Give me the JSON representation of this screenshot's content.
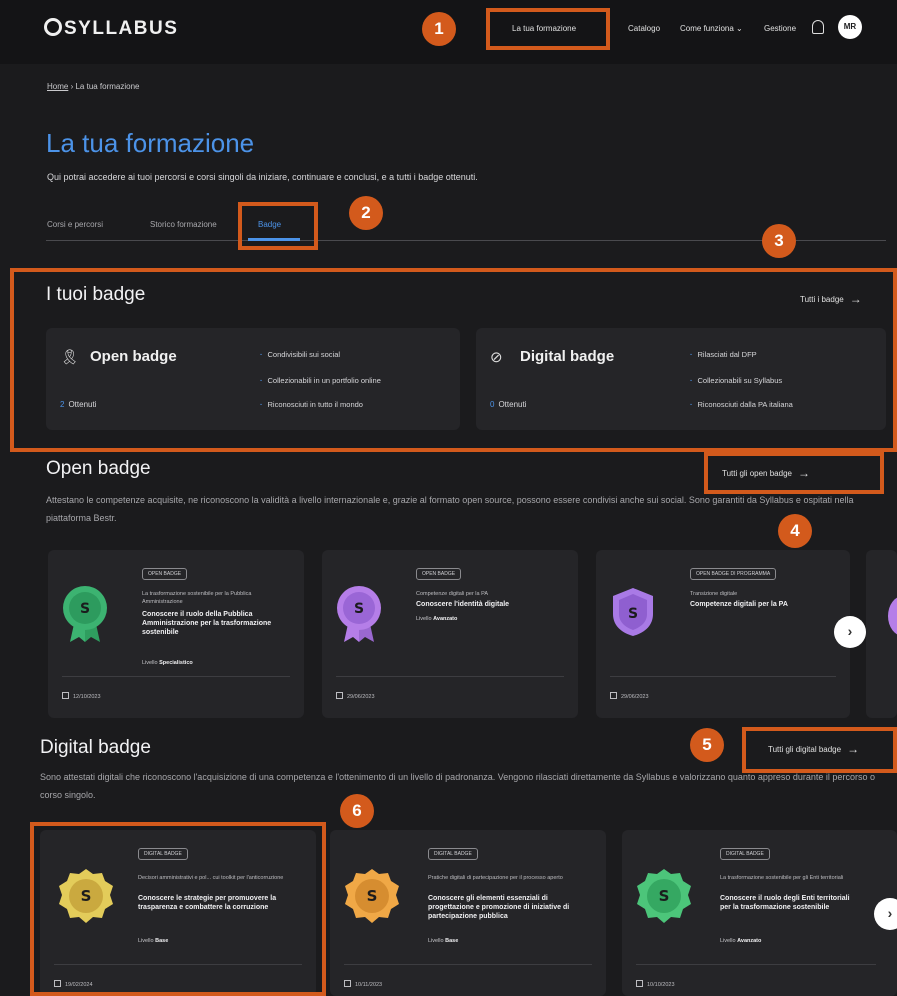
{
  "header": {
    "logo": "SYLLABUS",
    "nav": [
      "La tua formazione",
      "Catalogo",
      "Come funziona",
      "Gestione"
    ],
    "avatar_initials": "MR"
  },
  "breadcrumb": {
    "home": "Home",
    "current": "La tua formazione"
  },
  "page": {
    "title": "La tua formazione",
    "subtitle": "Qui potrai accedere ai tuoi percorsi e corsi singoli da iniziare, continuare e conclusi, e a tutti i badge ottenuti."
  },
  "tabs": [
    "Corsi e percorsi",
    "Storico formazione",
    "Badge"
  ],
  "summary": {
    "title": "I tuoi badge",
    "see_all": "Tutti i badge",
    "open": {
      "title": "Open badge",
      "count": "2",
      "count_label": "Ottenuti",
      "features": [
        "Condivisibili sui social",
        "Collezionabili in un portfolio online",
        "Riconosciuti in tutto il mondo"
      ]
    },
    "digital": {
      "title": "Digital badge",
      "count": "0",
      "count_label": "Ottenuti",
      "features": [
        "Rilasciati dal DFP",
        "Collezionabili su Syllabus",
        "Riconosciuti dalla PA italiana"
      ]
    }
  },
  "open_section": {
    "title": "Open badge",
    "see_all": "Tutti gli open badge",
    "description": "Attestano le competenze acquisite, ne riconoscono la validità a livello internazionale e, grazie al formato open source, possono essere condivisi anche sui social. Sono garantiti da Syllabus e ospitati nella piattaforma Bestr.",
    "cards": [
      {
        "pill": "OPEN BADGE",
        "category": "La trasformazione sostenibile per la Pubblica Amministrazione",
        "name": "Conoscere il ruolo della Pubblica Amministrazione per la trasformazione sostenibile",
        "level_label": "Livello",
        "level": "Specialistico",
        "date": "12/10/2023",
        "color": "#3cb371"
      },
      {
        "pill": "OPEN BADGE",
        "category": "Competenze digitali per la PA",
        "name": "Conoscere l'identità digitale",
        "level_label": "Livello",
        "level": "Avanzato",
        "date": "29/06/2023",
        "color": "#b57ee8"
      },
      {
        "pill": "OPEN BADGE DI PROGRAMMA",
        "category": "Transizione digitale",
        "name": "Competenze digitali per la PA",
        "level_label": "",
        "level": "",
        "date": "29/06/2023",
        "color": "#a97ae6"
      }
    ]
  },
  "digital_section": {
    "title": "Digital badge",
    "see_all": "Tutti gli digital badge",
    "description": "Sono attestati digitali che riconoscono l'acquisizione di una competenza e l'ottenimento di un livello di padronanza. Vengono rilasciati direttamente da Syllabus e valorizzano quanto appreso durante il percorso o corso singolo.",
    "cards": [
      {
        "pill": "DIGITAL BADGE",
        "category": "Decisori amministrativi e pol... cui toolkit per l'anticorruzione",
        "name": "Conoscere le strategie per promuovere la trasparenza e combattere la corruzione",
        "level_label": "Livello",
        "level": "Base",
        "date": "19/02/2024",
        "color": "#e3cc5a"
      },
      {
        "pill": "DIGITAL BADGE",
        "category": "Pratiche digitali di partecipazione per il processo aperto",
        "name": "Conoscere gli elementi essenziali di progettazione e promozione di iniziative di partecipazione pubblica",
        "level_label": "Livello",
        "level": "Base",
        "date": "10/11/2023",
        "color": "#f0a846"
      },
      {
        "pill": "DIGITAL BADGE",
        "category": "La trasformazione sostenibile per gli Enti territoriali",
        "name": "Conoscere il ruolo degli Enti territoriali per la trasformazione sostenibile",
        "level_label": "Livello",
        "level": "Avanzato",
        "date": "10/10/2023",
        "color": "#4cc57a"
      }
    ]
  },
  "annotations": [
    "1",
    "2",
    "3",
    "4",
    "5",
    "6"
  ],
  "colors": {
    "accent": "#4c93e8",
    "annotation": "#d35a1c",
    "background": "#1b1b1d",
    "card": "#252528"
  }
}
